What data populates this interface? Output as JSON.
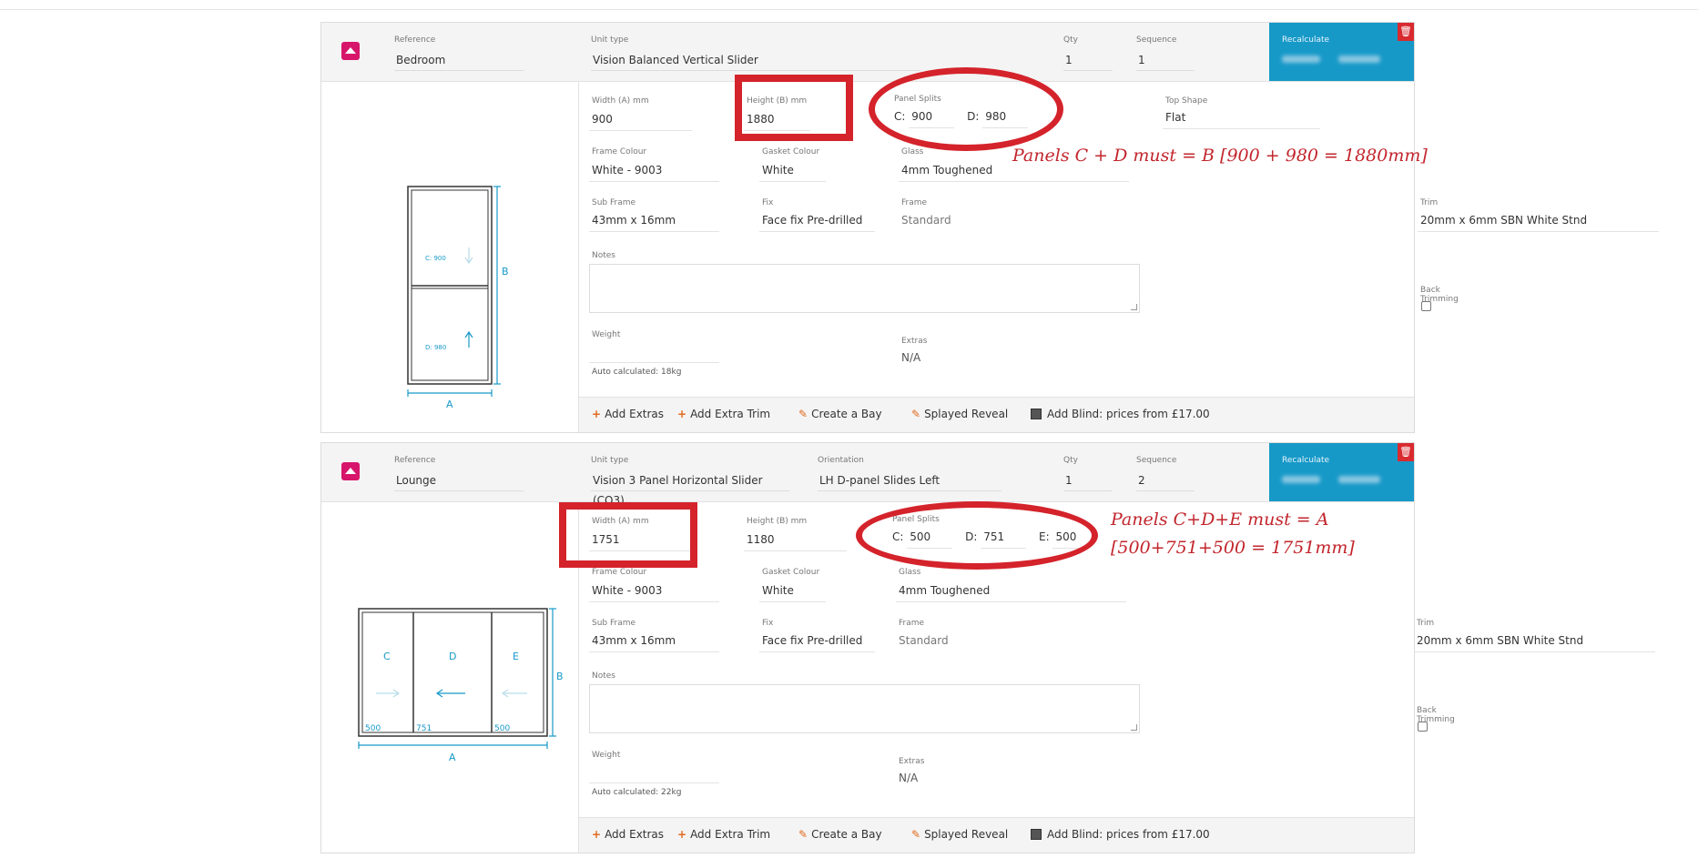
{
  "icons": {
    "collapse": "chevron-up-icon",
    "delete": "trash-icon",
    "add": "plus-icon",
    "edit": "pencil-icon",
    "blind": "blind-icon"
  },
  "colors": {
    "accent": "#d6156b",
    "recalc": "#1799c8",
    "annotation": "#d4232b",
    "action_icon": "#e06b1f"
  },
  "cards": [
    {
      "header": {
        "reference_label": "Reference",
        "reference": "Bedroom",
        "unit_type_label": "Unit type",
        "unit_type": "Vision Balanced Vertical Slider",
        "qty_label": "Qty",
        "qty": "1",
        "sequence_label": "Sequence",
        "sequence": "1",
        "recalculate": "Recalculate"
      },
      "diagram": {
        "panel_c": "C: 900",
        "panel_d": "D: 980",
        "dim_a": "A",
        "dim_b": "B"
      },
      "form": {
        "width_label": "Width (A) mm",
        "width": "900",
        "height_label": "Height (B) mm",
        "height": "1880",
        "panel_splits_label": "Panel Splits",
        "split_c_label": "C:",
        "split_c": "900",
        "split_d_label": "D:",
        "split_d": "980",
        "top_shape_label": "Top Shape",
        "top_shape": "Flat",
        "frame_colour_label": "Frame Colour",
        "frame_colour": "White - 9003",
        "gasket_colour_label": "Gasket Colour",
        "gasket_colour": "White",
        "glass_label": "Glass",
        "glass": "4mm Toughened",
        "sub_frame_label": "Sub Frame",
        "sub_frame": "43mm x 16mm",
        "fix_label": "Fix",
        "fix": "Face fix Pre-drilled",
        "frame_label": "Frame",
        "frame": "Standard",
        "trim_label": "Trim",
        "trim": "20mm x 6mm SBN White Stnd",
        "notes_label": "Notes",
        "back_trimming_label": "Back Trimming",
        "weight_label": "Weight",
        "weight_auto": "Auto calculated: 18kg",
        "extras_label": "Extras",
        "extras": "N/A"
      },
      "annotation": "Panels C + D must = B [900 + 980 = 1880mm]"
    },
    {
      "header": {
        "reference_label": "Reference",
        "reference": "Lounge",
        "unit_type_label": "Unit type",
        "unit_type": "Vision 3 Panel Horizontal Slider (CO3)",
        "orientation_label": "Orientation",
        "orientation": "LH D-panel Slides Left",
        "qty_label": "Qty",
        "qty": "1",
        "sequence_label": "Sequence",
        "sequence": "2",
        "recalculate": "Recalculate"
      },
      "diagram": {
        "panel_c": "C",
        "panel_d": "D",
        "panel_e": "E",
        "val_c": "500",
        "val_d": "751",
        "val_e": "500",
        "dim_a": "A",
        "dim_b": "B"
      },
      "form": {
        "width_label": "Width (A) mm",
        "width": "1751",
        "height_label": "Height (B) mm",
        "height": "1180",
        "panel_splits_label": "Panel Splits",
        "split_c_label": "C:",
        "split_c": "500",
        "split_d_label": "D:",
        "split_d": "751",
        "split_e_label": "E:",
        "split_e": "500",
        "frame_colour_label": "Frame Colour",
        "frame_colour": "White - 9003",
        "gasket_colour_label": "Gasket Colour",
        "gasket_colour": "White",
        "glass_label": "Glass",
        "glass": "4mm Toughened",
        "sub_frame_label": "Sub Frame",
        "sub_frame": "43mm x 16mm",
        "fix_label": "Fix",
        "fix": "Face fix Pre-drilled",
        "frame_label": "Frame",
        "frame": "Standard",
        "trim_label": "Trim",
        "trim": "20mm x 6mm SBN White Stnd",
        "notes_label": "Notes",
        "back_trimming_label": "Back Trimming",
        "weight_label": "Weight",
        "weight_auto": "Auto calculated: 22kg",
        "extras_label": "Extras",
        "extras": "N/A"
      },
      "annotation_line1": "Panels C+D+E must = A",
      "annotation_line2": "[500+751+500 = 1751mm]"
    }
  ],
  "actions": {
    "add_extras": "Add Extras",
    "add_extra_trim": "Add Extra Trim",
    "create_bay": "Create a Bay",
    "splayed_reveal": "Splayed Reveal",
    "add_blind": "Add Blind: prices from £17.00"
  }
}
